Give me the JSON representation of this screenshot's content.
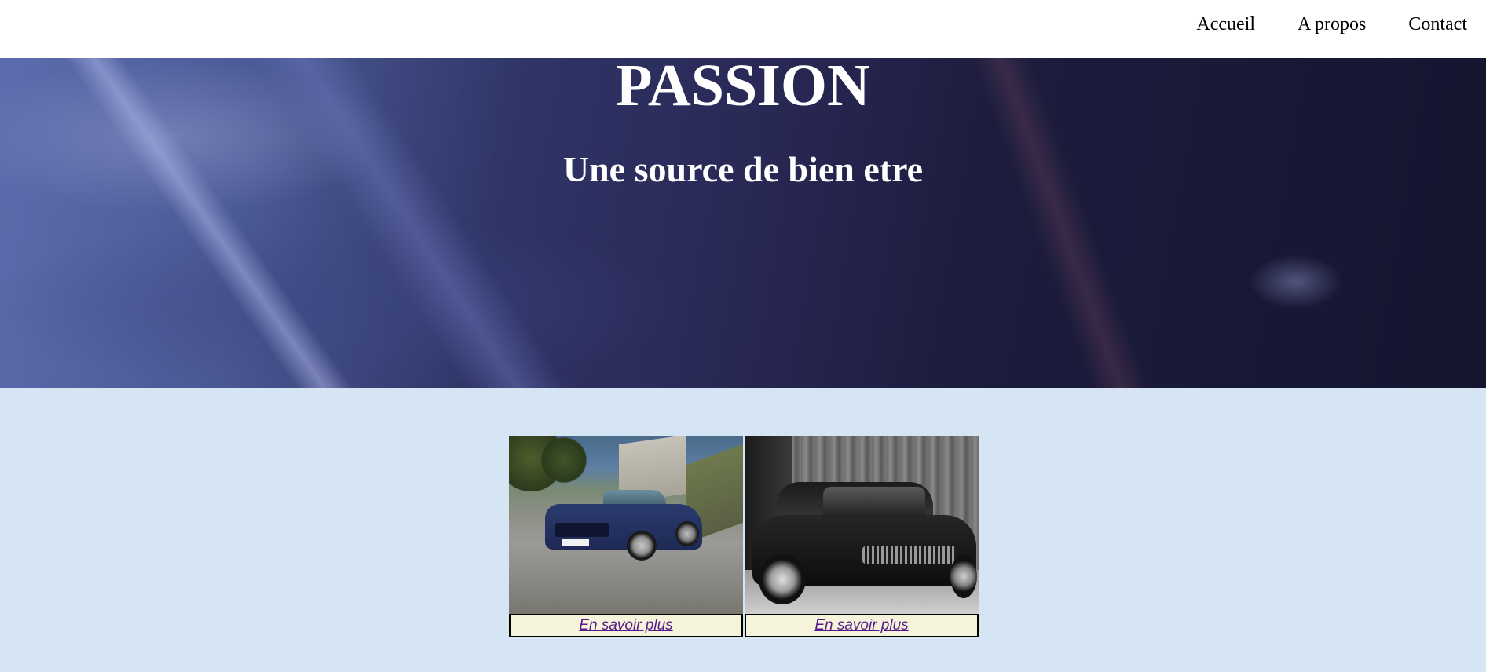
{
  "nav": {
    "items": [
      {
        "label": "Accueil"
      },
      {
        "label": "A propos"
      },
      {
        "label": "Contact"
      }
    ]
  },
  "hero": {
    "title": "PASSION",
    "subtitle": "Une source de bien etre"
  },
  "gallery": {
    "cards": [
      {
        "link_label": "En savoir plus"
      },
      {
        "link_label": "En savoir plus"
      }
    ]
  },
  "colors": {
    "background": "#d5e5f3",
    "header": "#ffffff",
    "link_cell": "#f5f4db",
    "link_text": "#551a8b"
  }
}
